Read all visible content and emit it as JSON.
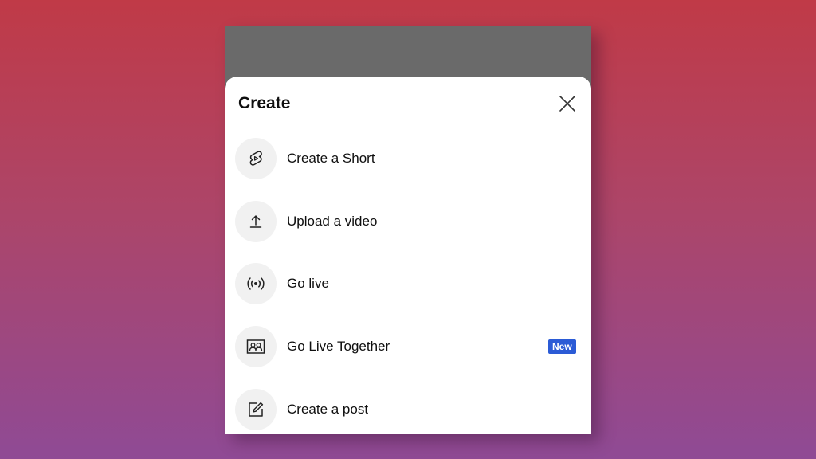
{
  "sheet": {
    "title": "Create",
    "close_icon": "close-icon"
  },
  "items": [
    {
      "label": "Create a Short",
      "icon": "shorts-icon"
    },
    {
      "label": "Upload a video",
      "icon": "upload-icon"
    },
    {
      "label": "Go live",
      "icon": "live-broadcast-icon"
    },
    {
      "label": "Go Live Together",
      "icon": "live-together-icon",
      "badge": "New"
    },
    {
      "label": "Create a post",
      "icon": "edit-post-icon"
    }
  ],
  "colors": {
    "badge": "#2b5bd6",
    "icon_circle": "#f1f1f1",
    "text": "#0f0f0f"
  }
}
